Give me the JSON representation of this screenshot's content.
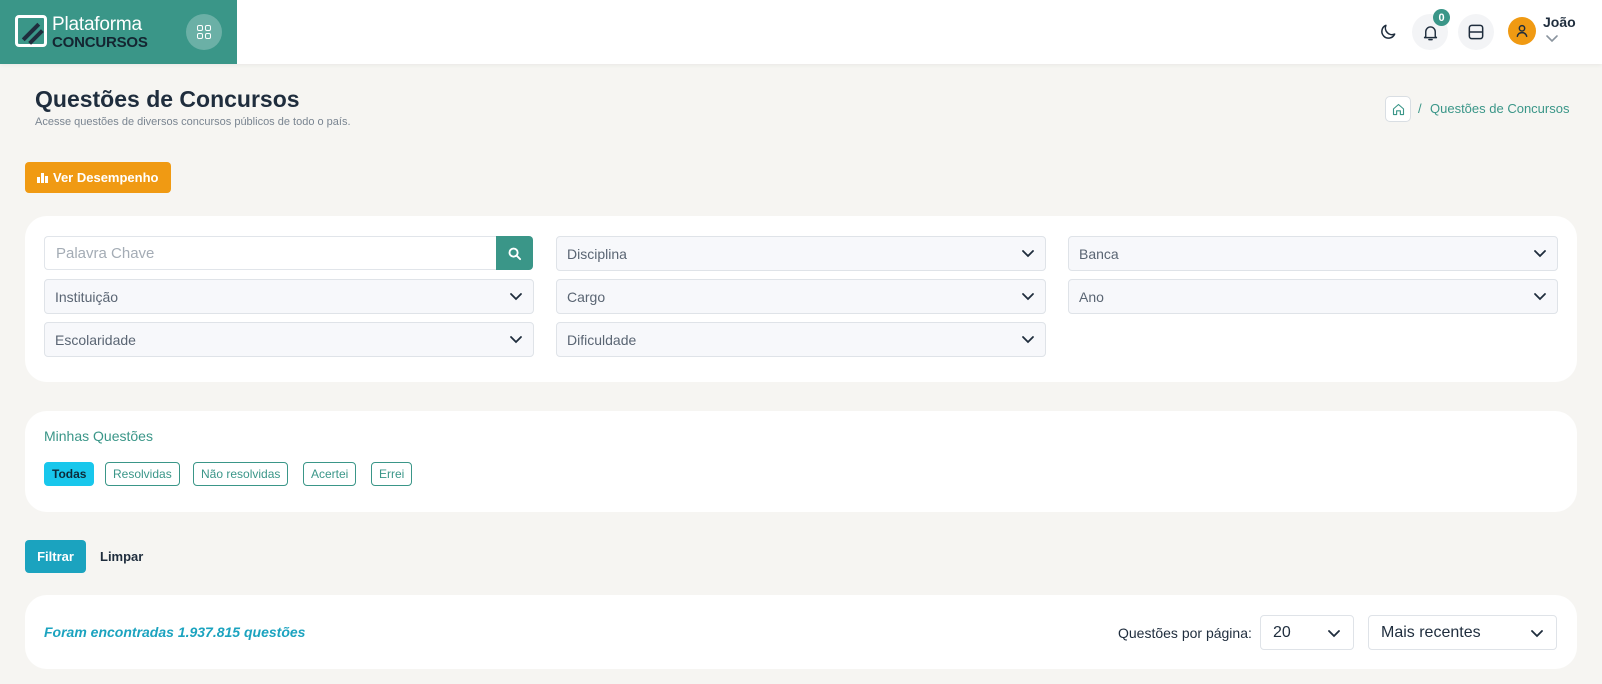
{
  "brand": {
    "line1": "Plataforma",
    "line2": "CONCURSOS",
    "color": "#3a9688"
  },
  "header": {
    "icons": [
      "grid-icon",
      "moon-icon",
      "bell-icon",
      "layout-icon",
      "user-icon",
      "chevron-down-icon"
    ],
    "notification_count": "0",
    "user_name": "João"
  },
  "page": {
    "title": "Questões de Concursos",
    "subtitle": "Acesse questões de diversos concursos públicos de todo o país.",
    "breadcrumb": {
      "separator": "/",
      "current": "Questões de Concursos"
    },
    "performance_button": "Ver Desempenho"
  },
  "filters": {
    "keyword_placeholder": "Palavra Chave",
    "fields": {
      "disciplina": "Disciplina",
      "banca": "Banca",
      "instituicao": "Instituição",
      "cargo": "Cargo",
      "ano": "Ano",
      "escolaridade": "Escolaridade",
      "dificuldade": "Dificuldade"
    }
  },
  "my_questions": {
    "title": "Minhas Questões",
    "options": [
      "Todas",
      "Resolvidas",
      "Não resolvidas",
      "Acertei",
      "Errei"
    ],
    "selected": "Todas"
  },
  "actions": {
    "filter": "Filtrar",
    "clear": "Limpar"
  },
  "results": {
    "found_text": "Foram encontradas 1.937.815 questões",
    "per_page_label": "Questões por página:",
    "per_page_value": "20",
    "sort_value": "Mais recentes"
  },
  "colors": {
    "accent": "#3a9688",
    "orange": "#f09a13",
    "cyan": "#1ba3bf",
    "active_pill": "#18c7ec"
  }
}
